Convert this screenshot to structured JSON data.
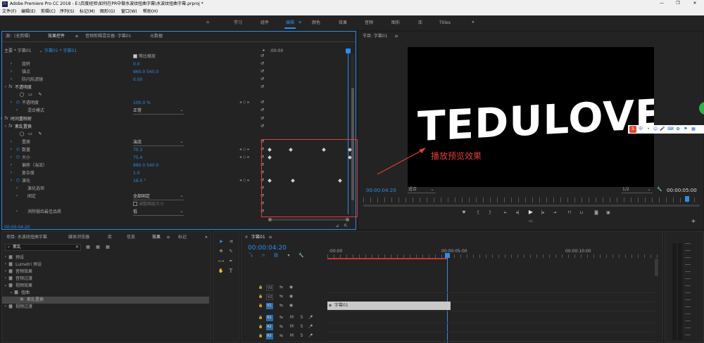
{
  "window": {
    "title": "Adobe Premiere Pro CC 2018 - E:\\百度经验\\如何在PR中做水波纹扭曲字幕\\水波纹扭曲字幕.prproj *"
  },
  "menu": [
    "文件(F)",
    "编辑(E)",
    "剪辑(C)",
    "序列(S)",
    "标记(M)",
    "图形(G)",
    "窗口(W)",
    "帮助(H)"
  ],
  "workspaces": [
    "学习",
    "组件",
    "编辑",
    "颜色",
    "效果",
    "音频",
    "图形",
    "库",
    "Titles"
  ],
  "topleft": {
    "tabs": [
      "源：(无剪辑)",
      "效果控件",
      "音频剪辑混合器: 字幕01",
      "元数据"
    ],
    "source_row": "主要 * 字幕01",
    "seq_row": "字幕01 * 字幕01",
    "ruler": ":00:00",
    "timecode": "00:00:04:20"
  },
  "effects": [
    {
      "label": "等比缩放",
      "value": ""
    },
    {
      "label": "旋转",
      "value": "0.0"
    },
    {
      "label": "锚点",
      "value": "960.0    540.0"
    },
    {
      "label": "防闪烁滤镜",
      "value": "0.00"
    },
    {
      "label": "不透明度",
      "value": ""
    },
    {
      "label": "不透明度",
      "value": "100.0 %"
    },
    {
      "label": "混合模式",
      "value": "正常"
    },
    {
      "label": "时间重映射",
      "value": ""
    },
    {
      "label": "紊乱置换",
      "value": ""
    },
    {
      "label": "置换",
      "value": "湍流"
    },
    {
      "label": "数量",
      "value": "70.3"
    },
    {
      "label": "大小",
      "value": "75.4"
    },
    {
      "label": "偏移（湍流）",
      "value": "960.0    540.0"
    },
    {
      "label": "复杂度",
      "value": "1.0"
    },
    {
      "label": "演化",
      "value": "16.0 °"
    },
    {
      "label": "演化选项",
      "value": ""
    },
    {
      "label": "固定",
      "value": "全部固定"
    },
    {
      "label": "",
      "value": "调整图层大小"
    },
    {
      "label": "消除锯齿最佳品质",
      "value": "低"
    }
  ],
  "program": {
    "title": "节目: 字幕01",
    "canvas_text": "TEDULOVE",
    "annotation": "播放预览效果",
    "timecode": "00:00:04:20",
    "fit": "适合",
    "quality": "1/2",
    "duration": "00:00:05:00"
  },
  "ime": {
    "label": "中"
  },
  "project": {
    "tabs": [
      "项目: 水波纹扭曲字幕",
      "媒体浏览器",
      "库",
      "信息",
      "效果",
      "标记"
    ],
    "search": "紊乱",
    "tree": [
      "预设",
      "Lumetri 预设",
      "音频效果",
      "音频过渡",
      "视频效果",
      "扭曲",
      "紊乱置换",
      "视频过渡"
    ]
  },
  "timeline": {
    "tab": "字幕01",
    "timecode": "00:00:04:20",
    "ruler": [
      ":00:00",
      "00:00:05:00",
      "00:00:10:00"
    ],
    "video_tracks": [
      "V3",
      "V2",
      "V1"
    ],
    "audio_tracks": [
      "A1",
      "A2",
      "A3"
    ],
    "clip": "字幕01"
  }
}
